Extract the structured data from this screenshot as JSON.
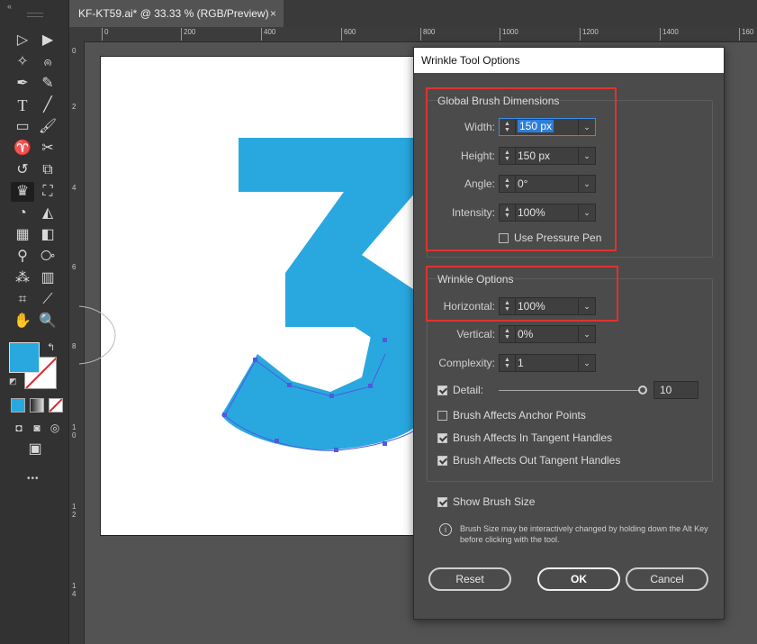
{
  "document": {
    "tab_title": "KF-KT59.ai* @ 33.33 % (RGB/Preview)",
    "close_glyph": "×"
  },
  "ruler": {
    "horizontal_ticks": [
      "0",
      "200",
      "400",
      "600",
      "800",
      "1000",
      "1200",
      "1400",
      "160"
    ],
    "vertical_ticks": [
      "0",
      "2",
      "4",
      "6",
      "8",
      "1 0",
      "1 2",
      "1 4"
    ]
  },
  "toolbar": {
    "collapse_glyph": "«",
    "more_glyph": "•••",
    "fill_color": "#29a8e0",
    "tools": [
      "selection-tool",
      "direct-selection-tool",
      "magic-wand-tool",
      "lasso-tool",
      "pen-tool",
      "curvature-tool",
      "type-tool",
      "line-tool",
      "rectangle-tool",
      "paintbrush-tool",
      "shaper-tool",
      "scissors-tool",
      "rotate-tool",
      "scale-tool",
      "wrinkle-tool",
      "free-transform-tool",
      "shape-builder-tool",
      "perspective-grid-tool",
      "mesh-tool",
      "gradient-tool",
      "eyedropper-tool",
      "blend-tool",
      "symbol-sprayer-tool",
      "column-graph-tool",
      "artboard-tool",
      "slice-tool",
      "hand-tool",
      "zoom-tool"
    ]
  },
  "artwork": {
    "glyph_color": "#29a8e0",
    "anchor_color": "#4f5bdc"
  },
  "dialog": {
    "title": "Wrinkle Tool Options",
    "global": {
      "title": "Global Brush Dimensions",
      "width_label": "Width:",
      "width_value": "150 px",
      "height_label": "Height:",
      "height_value": "150 px",
      "angle_label": "Angle:",
      "angle_value": "0°",
      "intensity_label": "Intensity:",
      "intensity_value": "100%",
      "pressure_label": "Use Pressure Pen",
      "pressure_checked": false
    },
    "wrinkle": {
      "title": "Wrinkle Options",
      "horizontal_label": "Horizontal:",
      "horizontal_value": "100%",
      "vertical_label": "Vertical:",
      "vertical_value": "0%",
      "complexity_label": "Complexity:",
      "complexity_value": "1",
      "detail_label": "Detail:",
      "detail_value": "10",
      "detail_checked": true,
      "anchor_label": "Brush Affects Anchor Points",
      "anchor_checked": false,
      "in_tangent_label": "Brush Affects In Tangent Handles",
      "in_tangent_checked": true,
      "out_tangent_label": "Brush Affects Out Tangent Handles",
      "out_tangent_checked": true
    },
    "show_brush_size_label": "Show Brush Size",
    "show_brush_size_checked": true,
    "info_text": "Brush Size may be interactively changed by holding down the Alt Key before clicking with the tool.",
    "buttons": {
      "reset": "Reset",
      "ok": "OK",
      "cancel": "Cancel"
    },
    "highlight_color": "#e0322e"
  }
}
